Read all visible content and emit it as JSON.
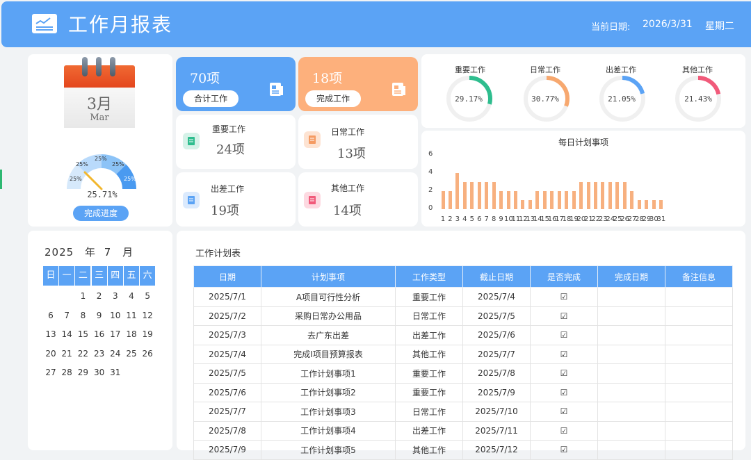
{
  "header": {
    "title": "工作月报表",
    "date_label": "当前日期:",
    "date_value": "2026/3/31",
    "weekday": "星期二"
  },
  "calendar_icon": {
    "month_cn": "3月",
    "month_en": "Mar"
  },
  "gauge": {
    "segments": [
      "25%",
      "25%",
      "25%",
      "25%"
    ],
    "value_text": "25.71%",
    "value": 25.71,
    "button": "完成进度"
  },
  "summary": {
    "total": {
      "count": "70项",
      "label": "合计工作",
      "color": "#5ba3f5"
    },
    "done": {
      "count": "18项",
      "label": "完成工作",
      "color": "#fdb07c"
    }
  },
  "categories": [
    {
      "label": "重要工作",
      "count": "24项",
      "color": "#2ebd8e"
    },
    {
      "label": "日常工作",
      "count": "13项",
      "color": "#f59b63"
    },
    {
      "label": "出差工作",
      "count": "19项",
      "color": "#5ba3f5"
    },
    {
      "label": "其他工作",
      "count": "14项",
      "color": "#f15a7a"
    }
  ],
  "rings": [
    {
      "label": "重要工作",
      "pct": "29.17%",
      "value": 29.17,
      "color": "#2ebd8e"
    },
    {
      "label": "日常工作",
      "pct": "30.77%",
      "value": 30.77,
      "color": "#f7a86f"
    },
    {
      "label": "出差工作",
      "pct": "21.05%",
      "value": 21.05,
      "color": "#5ba3f5"
    },
    {
      "label": "其他工作",
      "pct": "21.43%",
      "value": 21.43,
      "color": "#f15a7a"
    }
  ],
  "chart_data": {
    "type": "bar",
    "title": "每日计划事项",
    "categories": [
      "1",
      "2",
      "3",
      "4",
      "5",
      "6",
      "7",
      "8",
      "9",
      "10",
      "11",
      "12",
      "13",
      "14",
      "15",
      "16",
      "17",
      "18",
      "19",
      "20",
      "21",
      "22",
      "23",
      "24",
      "25",
      "26",
      "27",
      "28",
      "29",
      "30",
      "31"
    ],
    "values": [
      2,
      2,
      4,
      3,
      3,
      3,
      3,
      3,
      2,
      2,
      2,
      1,
      1,
      2,
      2,
      2,
      2,
      2,
      2,
      3,
      3,
      3,
      3,
      3,
      3,
      3,
      2,
      1,
      1,
      1,
      1
    ],
    "ylim": [
      0,
      6
    ],
    "yticks": [
      "0",
      "2",
      "4",
      "6"
    ],
    "color": "#f7b07f"
  },
  "mini_calendar": {
    "year": "2025",
    "year_unit": "年",
    "month": "7",
    "month_unit": "月",
    "weekdays": [
      "日",
      "一",
      "二",
      "三",
      "四",
      "五",
      "六"
    ],
    "weeks": [
      [
        "",
        "",
        "1",
        "2",
        "3",
        "4",
        "5"
      ],
      [
        "6",
        "7",
        "8",
        "9",
        "10",
        "11",
        "12"
      ],
      [
        "13",
        "14",
        "15",
        "16",
        "17",
        "18",
        "19"
      ],
      [
        "20",
        "21",
        "22",
        "23",
        "24",
        "25",
        "26"
      ],
      [
        "27",
        "28",
        "29",
        "30",
        "31",
        "",
        ""
      ]
    ]
  },
  "table": {
    "title": "工作计划表",
    "columns": [
      "日期",
      "计划事项",
      "工作类型",
      "截止日期",
      "是否完成",
      "完成日期",
      "备注信息"
    ],
    "rows": [
      [
        "2025/7/1",
        "A项目可行性分析",
        "重要工作",
        "2025/7/4",
        "☑",
        "",
        ""
      ],
      [
        "2025/7/2",
        "采购日常办公用品",
        "日常工作",
        "2025/7/5",
        "☑",
        "",
        ""
      ],
      [
        "2025/7/3",
        "去广东出差",
        "出差工作",
        "2025/7/6",
        "☑",
        "",
        ""
      ],
      [
        "2025/7/4",
        "完成I项目预算报表",
        "其他工作",
        "2025/7/7",
        "☑",
        "",
        ""
      ],
      [
        "2025/7/5",
        "工作计划事项1",
        "重要工作",
        "2025/7/8",
        "☑",
        "",
        ""
      ],
      [
        "2025/7/6",
        "工作计划事项2",
        "重要工作",
        "2025/7/9",
        "☑",
        "",
        ""
      ],
      [
        "2025/7/7",
        "工作计划事项3",
        "日常工作",
        "2025/7/10",
        "☑",
        "",
        ""
      ],
      [
        "2025/7/8",
        "工作计划事项4",
        "出差工作",
        "2025/7/11",
        "☑",
        "",
        ""
      ],
      [
        "2025/7/9",
        "工作计划事项5",
        "其他工作",
        "2025/7/12",
        "☑",
        "",
        ""
      ]
    ]
  }
}
